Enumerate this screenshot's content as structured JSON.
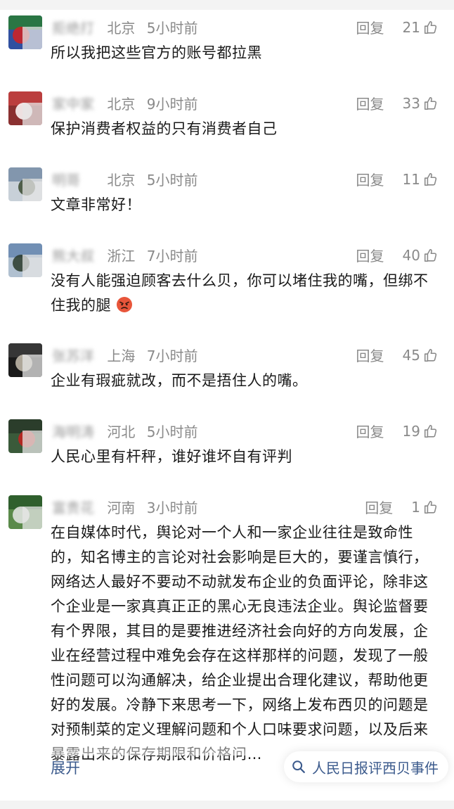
{
  "comments": [
    {
      "username": "拒绝打开",
      "location": "北京",
      "time": "5小时前",
      "reply_label": "回复",
      "likes": "21",
      "text": "所以我把这些官方的账号都拉黑",
      "avatar_colors": [
        "#2a7a3a",
        "#d62020",
        "#3050a0"
      ]
    },
    {
      "username": "家中家活",
      "location": "北京",
      "time": "9小时前",
      "reply_label": "回复",
      "likes": "33",
      "text": "保护消费者权益的只有消费者自己",
      "avatar_colors": [
        "#c04040",
        "#ffffff",
        "#8a3030"
      ]
    },
    {
      "username": "明哥",
      "location": "北京",
      "time": "5小时前",
      "reply_label": "回复",
      "likes": "11",
      "text": "文章非常好！",
      "avatar_colors": [
        "#7a8fa8",
        "#3a4a30",
        "#c8d0d8"
      ]
    },
    {
      "username": "熊大叔",
      "location": "浙江",
      "time": "7小时前",
      "reply_label": "回复",
      "likes": "40",
      "text": "没有人能强迫顾客去什么贝，你可以堵住我的嘴，但绑不住我的腿",
      "emoji": "angry-face",
      "avatar_colors": [
        "#6a8ab0",
        "#2a3a2a",
        "#b0c0d0"
      ]
    },
    {
      "username": "张苏洋",
      "location": "上海",
      "time": "7小时前",
      "reply_label": "回复",
      "likes": "45",
      "text": "企业有瑕疵就改，而不是捂住人的嘴。",
      "avatar_colors": [
        "#3a3a3a",
        "#c8c0b0",
        "#1a1a1a"
      ]
    },
    {
      "username": "海明涛",
      "location": "河北",
      "time": "5小时前",
      "reply_label": "回复",
      "likes": "19",
      "text": "人民心里有杆秤，谁好谁坏自有评判",
      "avatar_colors": [
        "#2a3a2a",
        "#c82020",
        "#3a5a3a"
      ]
    },
    {
      "username": "富贵花开",
      "location": "河南",
      "time": "3小时前",
      "reply_label": "回复",
      "likes": "1",
      "text": "在自媒体时代，舆论对一个人和一家企业往往是致命性的，知名博主的言论对社会影响是巨大的，要谨言慎行，网络达人最好不要动不动就发布企业的负面评论，除非这个企业是一家真真正正的黑心无良违法企业。舆论监督要有个界限，其目的是要推进经济社会向好的方向发展，企业在经营过程中难免会存在这样那样的问题，发现了一般性问题可以沟通解决，给企业提出合理化建议，帮助他更好的发展。冷静下来思考一下，网络上发布西贝的问题是对预制菜的定义理解问题和个人口味要求问题，以及后来暴露出来的保存期限和价格问…",
      "avatar_colors": [
        "#2a5a2a",
        "#e8e8e8",
        "#5a8a4a"
      ]
    }
  ],
  "expand_label": "展开",
  "search_chip": {
    "label": "人民日报评西贝事件",
    "icon": "search-icon"
  },
  "colors": {
    "meta_gray": "#8a8a8a",
    "text": "#1a1a1a",
    "link_blue": "#3b5a8c"
  }
}
